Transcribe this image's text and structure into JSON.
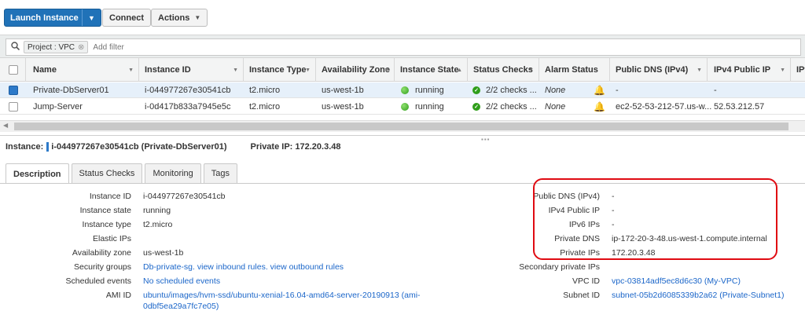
{
  "toolbar": {
    "launch_label": "Launch Instance",
    "connect_label": "Connect",
    "actions_label": "Actions"
  },
  "filter": {
    "chip_label": "Project : VPC",
    "placeholder": "Add filter"
  },
  "grid": {
    "columns": [
      "Name",
      "Instance ID",
      "Instance Type",
      "Availability Zone",
      "Instance State",
      "Status Checks",
      "Alarm Status",
      "Public DNS (IPv4)",
      "IPv4 Public IP",
      "IPv"
    ],
    "rows": [
      {
        "name": "Private-DbServer01",
        "instance_id": "i-044977267e30541cb",
        "type": "t2.micro",
        "az": "us-west-1b",
        "state": "running",
        "status_checks": "2/2 checks ...",
        "alarm": "None",
        "public_dns": "-",
        "ipv4": "-",
        "selected": true
      },
      {
        "name": "Jump-Server",
        "instance_id": "i-0d417b833a7945e5c",
        "type": "t2.micro",
        "az": "us-west-1b",
        "state": "running",
        "status_checks": "2/2 checks ...",
        "alarm": "None",
        "public_dns": "ec2-52-53-212-57.us-w...",
        "ipv4": "52.53.212.57",
        "selected": false
      }
    ]
  },
  "instance_line": {
    "prefix": "Instance:",
    "value": "i-044977267e30541cb (Private-DbServer01)",
    "private_ip": "Private IP: 172.20.3.48"
  },
  "tabs": [
    "Description",
    "Status Checks",
    "Monitoring",
    "Tags"
  ],
  "details_left": [
    {
      "label": "Instance ID",
      "value": "i-044977267e30541cb"
    },
    {
      "label": "Instance state",
      "value": "running"
    },
    {
      "label": "Instance type",
      "value": "t2.micro"
    },
    {
      "label": "Elastic IPs",
      "value": ""
    },
    {
      "label": "Availability zone",
      "value": "us-west-1b"
    },
    {
      "label": "Security groups",
      "value": "Db-private-sg. view inbound rules. view outbound rules"
    },
    {
      "label": "Scheduled events",
      "value": "No scheduled events"
    },
    {
      "label": "AMI ID",
      "value": "ubuntu/images/hvm-ssd/ubuntu-xenial-16.04-amd64-server-20190913 (ami-",
      "value2": "0dbf5ea29a7fc7e05)"
    }
  ],
  "details_right": [
    {
      "label": "Public DNS (IPv4)",
      "value": "-"
    },
    {
      "label": "IPv4 Public IP",
      "value": "-"
    },
    {
      "label": "IPv6 IPs",
      "value": "-"
    },
    {
      "label": "Private DNS",
      "value": "ip-172-20-3-48.us-west-1.compute.internal"
    },
    {
      "label": "Private IPs",
      "value": "172.20.3.48"
    },
    {
      "label": "Secondary private IPs",
      "value": ""
    },
    {
      "label": "VPC ID",
      "value": "vpc-03814adf5ec8d6c30 (My-VPC)"
    },
    {
      "label": "Subnet ID",
      "value": "subnet-05b2d6085339b2a62 (Private-Subnet1)"
    }
  ],
  "colors": {
    "primary_button": "#2072b8",
    "link": "#1b66c9",
    "highlight_box": "#e00b12",
    "selected_row": "#e6f0fa"
  }
}
